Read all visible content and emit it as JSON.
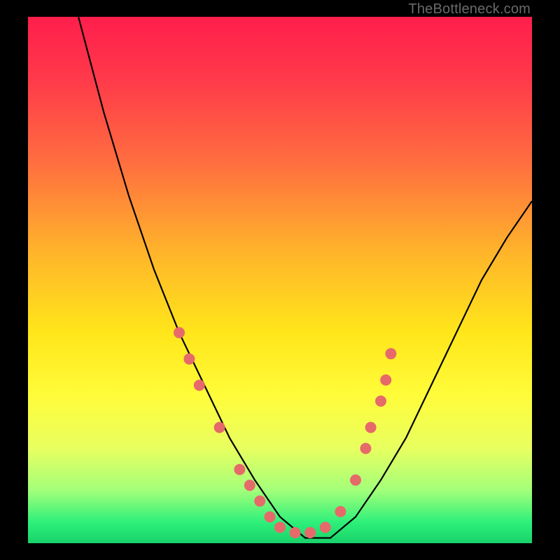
{
  "watermark": "TheBottleneck.com",
  "chart_data": {
    "type": "line",
    "title": "",
    "xlabel": "",
    "ylabel": "",
    "xlim": [
      0,
      100
    ],
    "ylim": [
      0,
      100
    ],
    "grid": false,
    "legend": false,
    "annotations": [],
    "background_gradient": {
      "stops": [
        {
          "pos": 0,
          "color": "#ff1e4c"
        },
        {
          "pos": 12,
          "color": "#ff3a4a"
        },
        {
          "pos": 28,
          "color": "#ff6f3f"
        },
        {
          "pos": 45,
          "color": "#ffb52a"
        },
        {
          "pos": 60,
          "color": "#ffe61a"
        },
        {
          "pos": 72,
          "color": "#fffc3a"
        },
        {
          "pos": 82,
          "color": "#e8ff60"
        },
        {
          "pos": 90,
          "color": "#a2ff7a"
        },
        {
          "pos": 96,
          "color": "#2ef07a"
        },
        {
          "pos": 100,
          "color": "#17d36a"
        }
      ]
    },
    "series": [
      {
        "name": "bottleneck-curve",
        "color": "#000000",
        "x": [
          10,
          15,
          20,
          25,
          30,
          35,
          40,
          45,
          50,
          55,
          60,
          65,
          70,
          75,
          80,
          85,
          90,
          95,
          100
        ],
        "y": [
          100,
          82,
          66,
          52,
          40,
          30,
          20,
          12,
          5,
          1,
          1,
          5,
          12,
          20,
          30,
          40,
          50,
          58,
          65
        ]
      }
    ],
    "markers": {
      "name": "highlight-dots",
      "color": "#e66a6a",
      "radius": 8,
      "points": [
        {
          "x": 30,
          "y": 40
        },
        {
          "x": 32,
          "y": 35
        },
        {
          "x": 34,
          "y": 30
        },
        {
          "x": 38,
          "y": 22
        },
        {
          "x": 42,
          "y": 14
        },
        {
          "x": 44,
          "y": 11
        },
        {
          "x": 46,
          "y": 8
        },
        {
          "x": 48,
          "y": 5
        },
        {
          "x": 50,
          "y": 3
        },
        {
          "x": 53,
          "y": 2
        },
        {
          "x": 56,
          "y": 2
        },
        {
          "x": 59,
          "y": 3
        },
        {
          "x": 62,
          "y": 6
        },
        {
          "x": 65,
          "y": 12
        },
        {
          "x": 67,
          "y": 18
        },
        {
          "x": 68,
          "y": 22
        },
        {
          "x": 70,
          "y": 27
        },
        {
          "x": 71,
          "y": 31
        },
        {
          "x": 72,
          "y": 36
        }
      ]
    }
  }
}
